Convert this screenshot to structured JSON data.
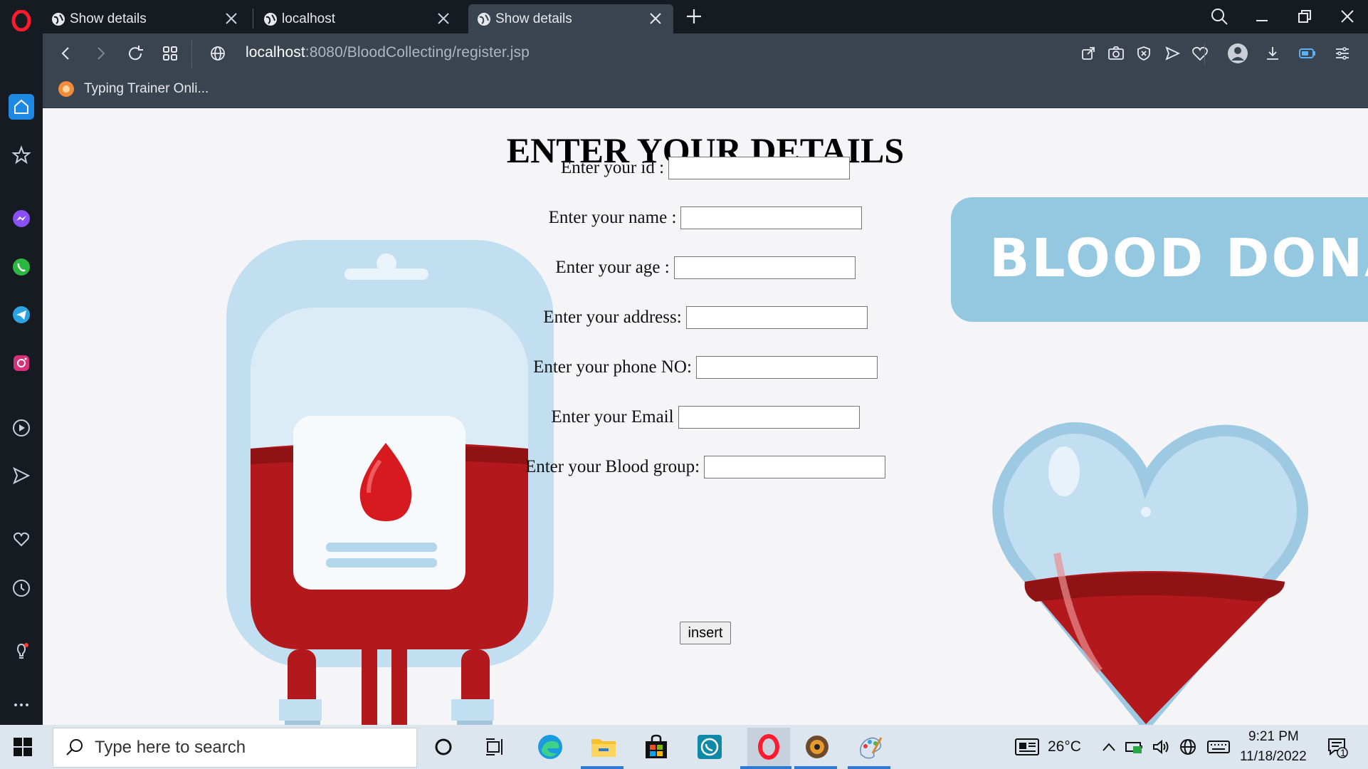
{
  "browser": {
    "tabs": [
      {
        "label": "Show details",
        "active": false
      },
      {
        "label": "localhost",
        "active": false
      },
      {
        "label": "Show details",
        "active": true
      }
    ],
    "address_bar": {
      "host": "localhost",
      "path": ":8080/BloodCollecting/register.jsp"
    },
    "bookmarks": [
      {
        "label": "Typing Trainer Onli..."
      }
    ]
  },
  "sidebar": {
    "items": [
      "home-icon",
      "star-icon",
      "messenger-icon",
      "whatsapp-icon",
      "telegram-icon",
      "instagram-icon",
      "player-icon",
      "flow-icon",
      "heart-icon",
      "history-icon",
      "tips-icon",
      "more-icon"
    ]
  },
  "page": {
    "title": "ENTER YOUR DETAILS",
    "fields": [
      {
        "label": "Enter your id :",
        "value": ""
      },
      {
        "label": "Enter your name :",
        "value": ""
      },
      {
        "label": "Enter your age :",
        "value": ""
      },
      {
        "label": "Enter your address:",
        "value": ""
      },
      {
        "label": "Enter your phone NO:",
        "value": ""
      },
      {
        "label": "Enter your Email",
        "value": ""
      },
      {
        "label": "Enter your Blood group:",
        "value": ""
      }
    ],
    "submit_label": "insert",
    "banner_text": "BLOOD DONAT"
  },
  "taskbar": {
    "search_placeholder": "Type here to search",
    "weather": "26°C",
    "time": "9:21 PM",
    "date": "11/18/2022",
    "notification_count": "1"
  },
  "colors": {
    "chrome_dark": "#161b22",
    "toolbar": "#3a4450",
    "page_bg": "#f5f5f7",
    "blood_red": "#b3191c",
    "bag_blue": "#bcdcf0",
    "banner_blue": "#93c8e0"
  }
}
